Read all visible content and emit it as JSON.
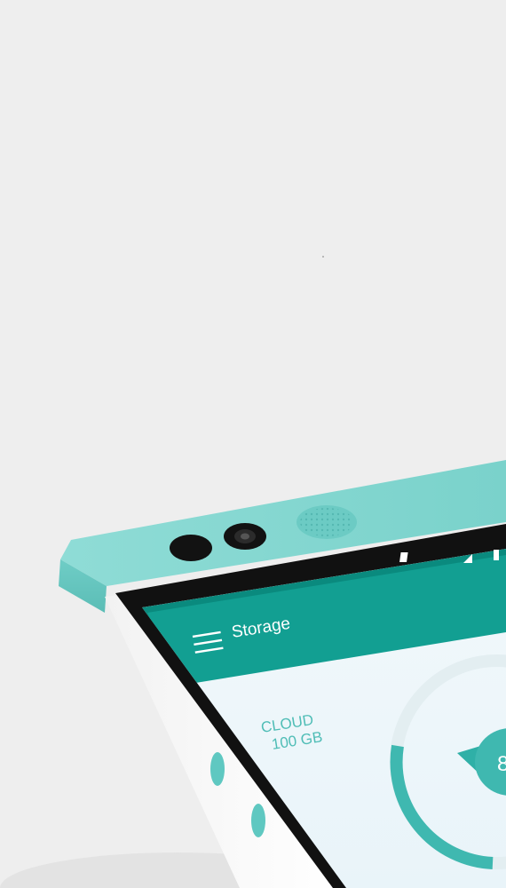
{
  "colors": {
    "background": "#eeeeee",
    "phone_teal": "#7fd6d0",
    "phone_teal_dark": "#5cbfb8",
    "phone_white": "#ffffff",
    "screen_bezel": "#111111",
    "toolbar_teal": "#0f9d8f",
    "accent": "#3fb8b0"
  },
  "device": {
    "front_camera_icon": "camera-icon",
    "sensor_icon": "sensor-icon",
    "speaker_icon": "speaker-grille-icon",
    "side_buttons": [
      "volume-up-button",
      "volume-down-button"
    ]
  },
  "app": {
    "title": "Storage",
    "menu_icon": "hamburger-menu-icon",
    "status_icons": [
      "signal-icon",
      "wifi-icon",
      "battery-icon"
    ],
    "storage": {
      "label": "CLOUD",
      "amount": "100 GB",
      "gauge_value_partial": "8",
      "gauge_fill_fraction": 0.6
    }
  }
}
